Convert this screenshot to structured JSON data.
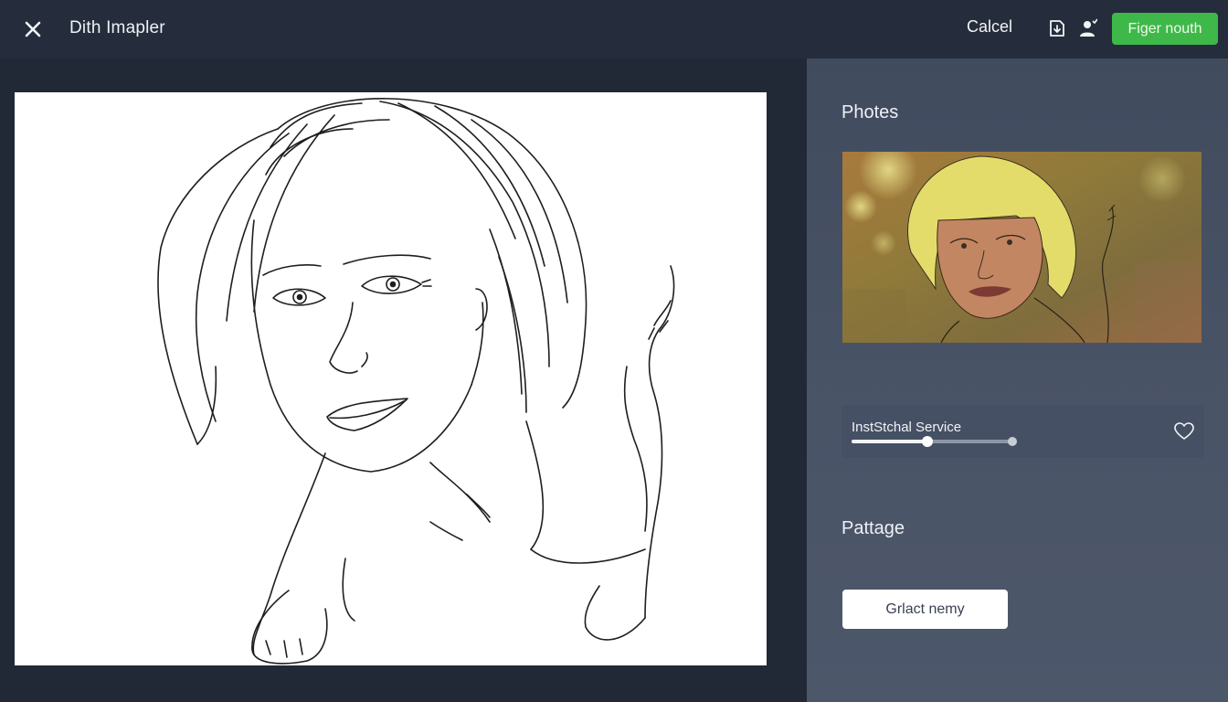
{
  "header": {
    "close_icon": "close-icon",
    "title": "Dith Imapler",
    "cancel_label": "Calcel",
    "icons": [
      "export-icon",
      "user-icon"
    ],
    "primary_label": "Figer nouth"
  },
  "panel": {
    "photos_heading": "Photes",
    "photo_icon": "image-thumbnail",
    "slider": {
      "label": "InstStchal Service",
      "value_percent": 47,
      "heart_icon": "heart-icon"
    },
    "page_heading": "Pattage",
    "select_label": "Grlact nemy"
  },
  "colors": {
    "accent_green": "#3fb84a",
    "topbar": "#252d3c",
    "panel": "#4a5467",
    "canvas": "#ffffff"
  }
}
